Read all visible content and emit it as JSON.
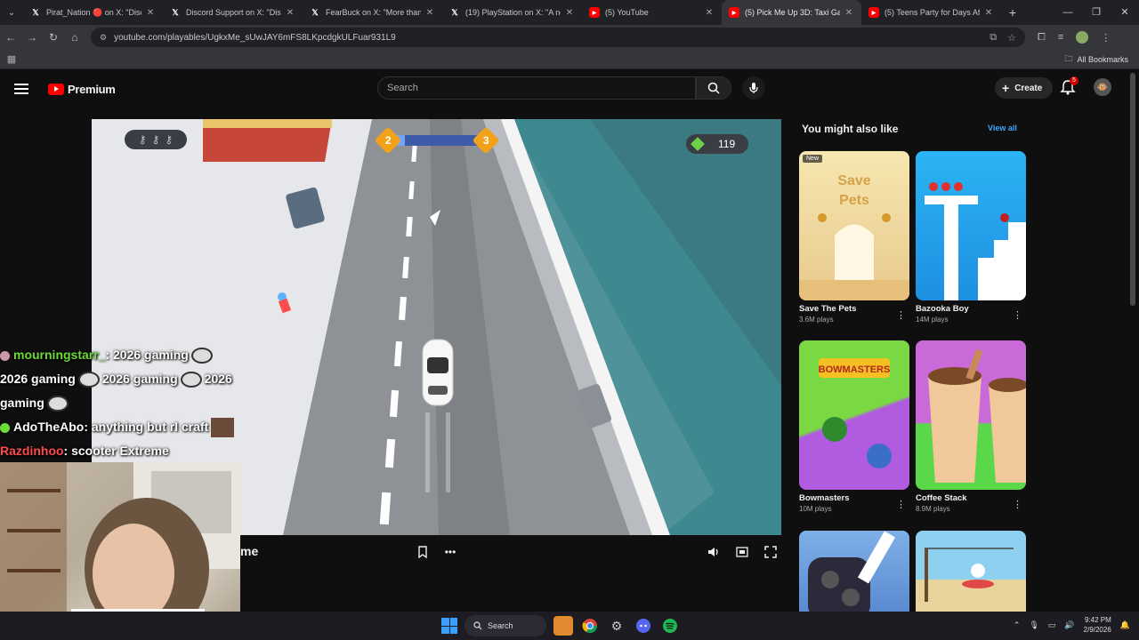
{
  "browser": {
    "tabs": [
      {
        "title": "Pirat_Nation 🔴 on X: \"Discord",
        "icon": "x-icon"
      },
      {
        "title": "Discord Support on X: \"Discord",
        "icon": "x-icon"
      },
      {
        "title": "FearBuck on X: \"More than 60",
        "icon": "x-icon"
      },
      {
        "title": "(19) PlayStation on X: \"A new S",
        "icon": "x-icon"
      },
      {
        "title": "(5) YouTube",
        "icon": "youtube-icon"
      },
      {
        "title": "(5) Pick Me Up 3D: Taxi Gam",
        "icon": "youtube-icon",
        "active": true
      },
      {
        "title": "(5) Teens Party for Days After E",
        "icon": "youtube-icon"
      }
    ],
    "url": "youtube.com/playables/UgkxMe_sUwJAY6mFS8LKpcdgkULFuar931L9",
    "bookmarks_label": "All Bookmarks"
  },
  "youtube": {
    "logo_text": "Premium",
    "search_placeholder": "Search",
    "create_label": "Create",
    "notification_count": "5"
  },
  "game": {
    "level_current": "2",
    "level_next": "3",
    "level_progress": 0.18,
    "cash": "119",
    "keys_count": 3
  },
  "player": {
    "title_fragment": "me"
  },
  "chat": [
    {
      "user": "mourningstarr_",
      "message": ": 2026 gaming",
      "extra": "2026 gaming",
      "extra2": "2026 gaming",
      "extra3": "2026",
      "extra4": "gaming"
    },
    {
      "user": "AdoTheAbo",
      "message": ": anything but rl craft"
    },
    {
      "user": "Razdinhoo",
      "message": ": scooter Extreme"
    }
  ],
  "sidebar": {
    "heading": "You might also like",
    "view_all": "View all",
    "cards": [
      {
        "name": "Save The Pets",
        "plays": "3.6M plays",
        "badge": "New",
        "color_top": "#f6e7b0",
        "color_bottom": "#e8c98e"
      },
      {
        "name": "Bazooka Boy",
        "plays": "14M plays",
        "color_top": "#2bb4f5",
        "color_bottom": "#1e8fe0"
      },
      {
        "name": "Bowmasters",
        "plays": "10M plays",
        "color_top": "#7ad843",
        "color_bottom": "#b05be0"
      },
      {
        "name": "Coffee Stack",
        "plays": "8.9M plays",
        "color_top": "#c96ad8",
        "color_bottom": "#5ad84a"
      },
      {
        "name": "",
        "plays": "",
        "color_top": "#7fb0e8",
        "color_bottom": "#2a2a3a"
      },
      {
        "name": "",
        "plays": "",
        "color_top": "#8ed0f0",
        "color_bottom": "#e8d49a"
      }
    ]
  },
  "taskbar": {
    "search_label": "Search",
    "time": "9:42 PM",
    "date": "2/9/2026"
  }
}
